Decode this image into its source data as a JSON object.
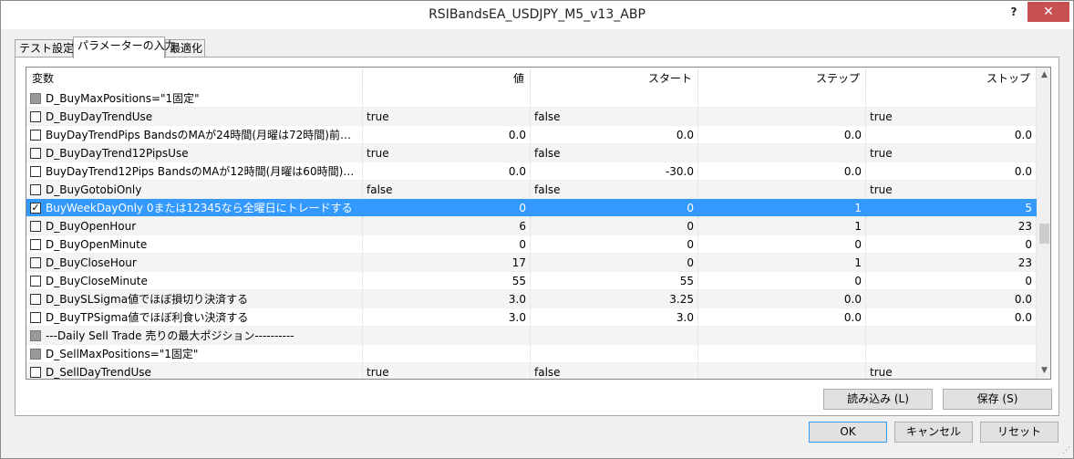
{
  "window": {
    "title": "RSIBandsEA_USDJPY_M5_v13_ABP",
    "help_label": "?",
    "close_label": "✕"
  },
  "tabs": [
    {
      "label": "テスト設定"
    },
    {
      "label": "パラメーターの入力"
    },
    {
      "label": "最適化"
    }
  ],
  "table": {
    "columns": [
      "変数",
      "値",
      "スタート",
      "ステップ",
      "ストップ"
    ],
    "rows": [
      {
        "checkbox": "disabled",
        "name": "D_BuyMaxPositions=\"1固定\"",
        "value": "",
        "start": "",
        "step": "",
        "stop": ""
      },
      {
        "checkbox": "unchecked",
        "name": "D_BuyDayTrendUse",
        "value": "true",
        "start": "false",
        "step": "",
        "stop": "true"
      },
      {
        "checkbox": "unchecked",
        "name": "BuyDayTrendPips BandsのMAが24時間(月曜は72時間)前の…",
        "value": "0.0",
        "start": "0.0",
        "step": "0.0",
        "stop": "0.0"
      },
      {
        "checkbox": "unchecked",
        "name": "D_BuyDayTrend12PipsUse",
        "value": "true",
        "start": "false",
        "step": "",
        "stop": "true"
      },
      {
        "checkbox": "unchecked",
        "name": "BuyDayTrend12Pips BandsのMAが12時間(月曜は60時間)前・…",
        "value": "0.0",
        "start": "-30.0",
        "step": "0.0",
        "stop": "0.0"
      },
      {
        "checkbox": "unchecked",
        "name": "D_BuyGotobiOnly",
        "value": "false",
        "start": "false",
        "step": "",
        "stop": "true"
      },
      {
        "checkbox": "checked",
        "name": "BuyWeekDayOnly 0または12345なら全曜日にトレードする",
        "value": "0",
        "start": "0",
        "step": "1",
        "stop": "5",
        "selected": true
      },
      {
        "checkbox": "unchecked",
        "name": "D_BuyOpenHour",
        "value": "6",
        "start": "0",
        "step": "1",
        "stop": "23"
      },
      {
        "checkbox": "unchecked",
        "name": "D_BuyOpenMinute",
        "value": "0",
        "start": "0",
        "step": "0",
        "stop": "0"
      },
      {
        "checkbox": "unchecked",
        "name": "D_BuyCloseHour",
        "value": "17",
        "start": "0",
        "step": "1",
        "stop": "23"
      },
      {
        "checkbox": "unchecked",
        "name": "D_BuyCloseMinute",
        "value": "55",
        "start": "55",
        "step": "0",
        "stop": "0"
      },
      {
        "checkbox": "unchecked",
        "name": "D_BuySLSigma値でほぼ損切り決済する",
        "value": "3.0",
        "start": "3.25",
        "step": "0.0",
        "stop": "0.0"
      },
      {
        "checkbox": "unchecked",
        "name": "D_BuyTPSigma値でほぼ利食い決済する",
        "value": "3.0",
        "start": "3.0",
        "step": "0.0",
        "stop": "0.0"
      },
      {
        "checkbox": "disabled",
        "name": "---Daily Sell Trade 売りの最大ポジション----------",
        "value": "",
        "start": "",
        "step": "",
        "stop": ""
      },
      {
        "checkbox": "disabled",
        "name": "D_SellMaxPositions=\"1固定\"",
        "value": "",
        "start": "",
        "step": "",
        "stop": ""
      },
      {
        "checkbox": "unchecked",
        "name": "D_SellDayTrendUse",
        "value": "true",
        "start": "false",
        "step": "",
        "stop": "true"
      }
    ]
  },
  "buttons": {
    "load": "読み込み (L)",
    "save": "保存 (S)",
    "ok": "OK",
    "cancel": "キャンセル",
    "reset": "リセット"
  },
  "icons": {
    "scroll_up": "▲",
    "scroll_down": "▼",
    "check": "✓",
    "grip": "⋰"
  }
}
